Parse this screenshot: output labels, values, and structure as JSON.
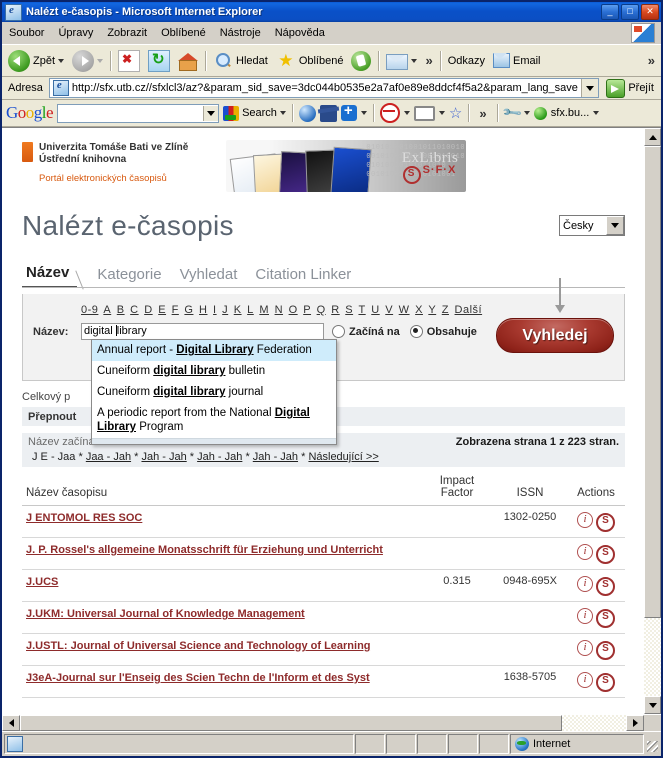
{
  "window": {
    "title": "Nalézt e-časopis - Microsoft Internet Explorer",
    "minimize": "_",
    "maximize": "□",
    "close": "✕"
  },
  "menu": [
    "Soubor",
    "Úpravy",
    "Zobrazit",
    "Oblíbené",
    "Nástroje",
    "Nápověda"
  ],
  "toolbar": {
    "back": "Zpět",
    "search": "Hledat",
    "favorites": "Oblíbené",
    "chevron": "»",
    "links_label": "Odkazy",
    "email_label": "Email",
    "right_chevron": "»"
  },
  "address": {
    "label": "Adresa",
    "url": "http://sfx.utb.cz//sfxlcl3/az?&param_sid_save=3dc044b0535e2a7af0e89e8ddcf4f5a2&param_lang_save",
    "go": "Přejít"
  },
  "google_toolbar": {
    "logo": "Google",
    "query": "",
    "search_label": "Search",
    "chevron": "»",
    "account": "sfx.bu..."
  },
  "page": {
    "logo": {
      "line1": "Univerzita Tomáše Bati ve Zlíně",
      "line2": "Ústřední knihovna",
      "tagline": "Portál elektronických časopisů"
    },
    "banner": {
      "exlibris": "ExLibris",
      "sfx": "S·F·X",
      "sfx_mark": "S",
      "binary": "0101010010010110100100101010 00101001010100101001010 01010010101011010 0010100101010101001"
    },
    "title": "Nalézt e-časopis",
    "language": "Česky",
    "tabs": [
      {
        "label": "Název",
        "active": true
      },
      {
        "label": "Kategorie",
        "active": false
      },
      {
        "label": "Vyhledat",
        "active": false
      },
      {
        "label": "Citation Linker",
        "active": false
      }
    ],
    "alphabet": [
      "0-9",
      "A",
      "B",
      "C",
      "D",
      "E",
      "F",
      "G",
      "H",
      "I",
      "J",
      "K",
      "L",
      "M",
      "N",
      "O",
      "P",
      "Q",
      "R",
      "S",
      "T",
      "U",
      "V",
      "W",
      "X",
      "Y",
      "Z",
      "Další"
    ],
    "search": {
      "label": "Název:",
      "value_before_caret": "digital ",
      "value_after_caret": "library",
      "full_value": "digital library",
      "radio_starts": "Začíná na",
      "radio_contains": "Obsahuje",
      "selected_radio": "Obsahuje",
      "submit": "Vyhledej"
    },
    "autocomplete": [
      {
        "pre": "Annual report - ",
        "match": "Digital Library",
        "post": " Federation",
        "selected": true
      },
      {
        "pre": "Cuneiform ",
        "match": "digital library",
        "post": " bulletin",
        "selected": false
      },
      {
        "pre": "Cuneiform ",
        "match": "digital library",
        "post": " journal",
        "selected": false
      },
      {
        "pre": "A periodic report from the National ",
        "match": "Digital Library",
        "post": " Program",
        "selected": false
      }
    ],
    "total_label": "Celkový p",
    "switch_label": "Přepnout",
    "starts_with_label": "Název začíná na:",
    "page_status": "Zobrazena strana 1 z 223 stran.",
    "pagination": {
      "current": "J E - Jaa",
      "sep": "*",
      "links": [
        "Jaa - Jah",
        "Jah - Jah",
        "Jah - Jah",
        "Jah - Jah"
      ],
      "next": "Následující >>"
    },
    "table": {
      "headers": [
        "Název časopisu",
        "Impact Factor",
        "ISSN",
        "Actions"
      ],
      "rows": [
        {
          "title": "J ENTOMOL RES SOC",
          "impact": "",
          "issn": "1302-0250"
        },
        {
          "title": "J. P. Rossel's allgemeine Monatsschrift für Erziehung und Unterricht",
          "impact": "",
          "issn": ""
        },
        {
          "title": "J.UCS",
          "impact": "0.315",
          "issn": "0948-695X"
        },
        {
          "title": "J.UKM: Universal Journal of Knowledge Management",
          "impact": "",
          "issn": ""
        },
        {
          "title": "J.USTL: Journal of Universal Science and Technology of Learning",
          "impact": "",
          "issn": ""
        },
        {
          "title": "J3eA-Journal sur l'Enseig des Scien Techn de l'Inform et des Syst",
          "impact": "",
          "issn": "1638-5705"
        }
      ],
      "action_info": "i",
      "action_sfx": "S"
    }
  },
  "status_bar": {
    "zone": "Internet"
  },
  "colors": {
    "title_bar": "#0a50c8",
    "link_red": "#8e2b2b",
    "button_red": "#a93a30",
    "accent_orange": "#d85a10",
    "page_title_gray": "#5a6470"
  }
}
